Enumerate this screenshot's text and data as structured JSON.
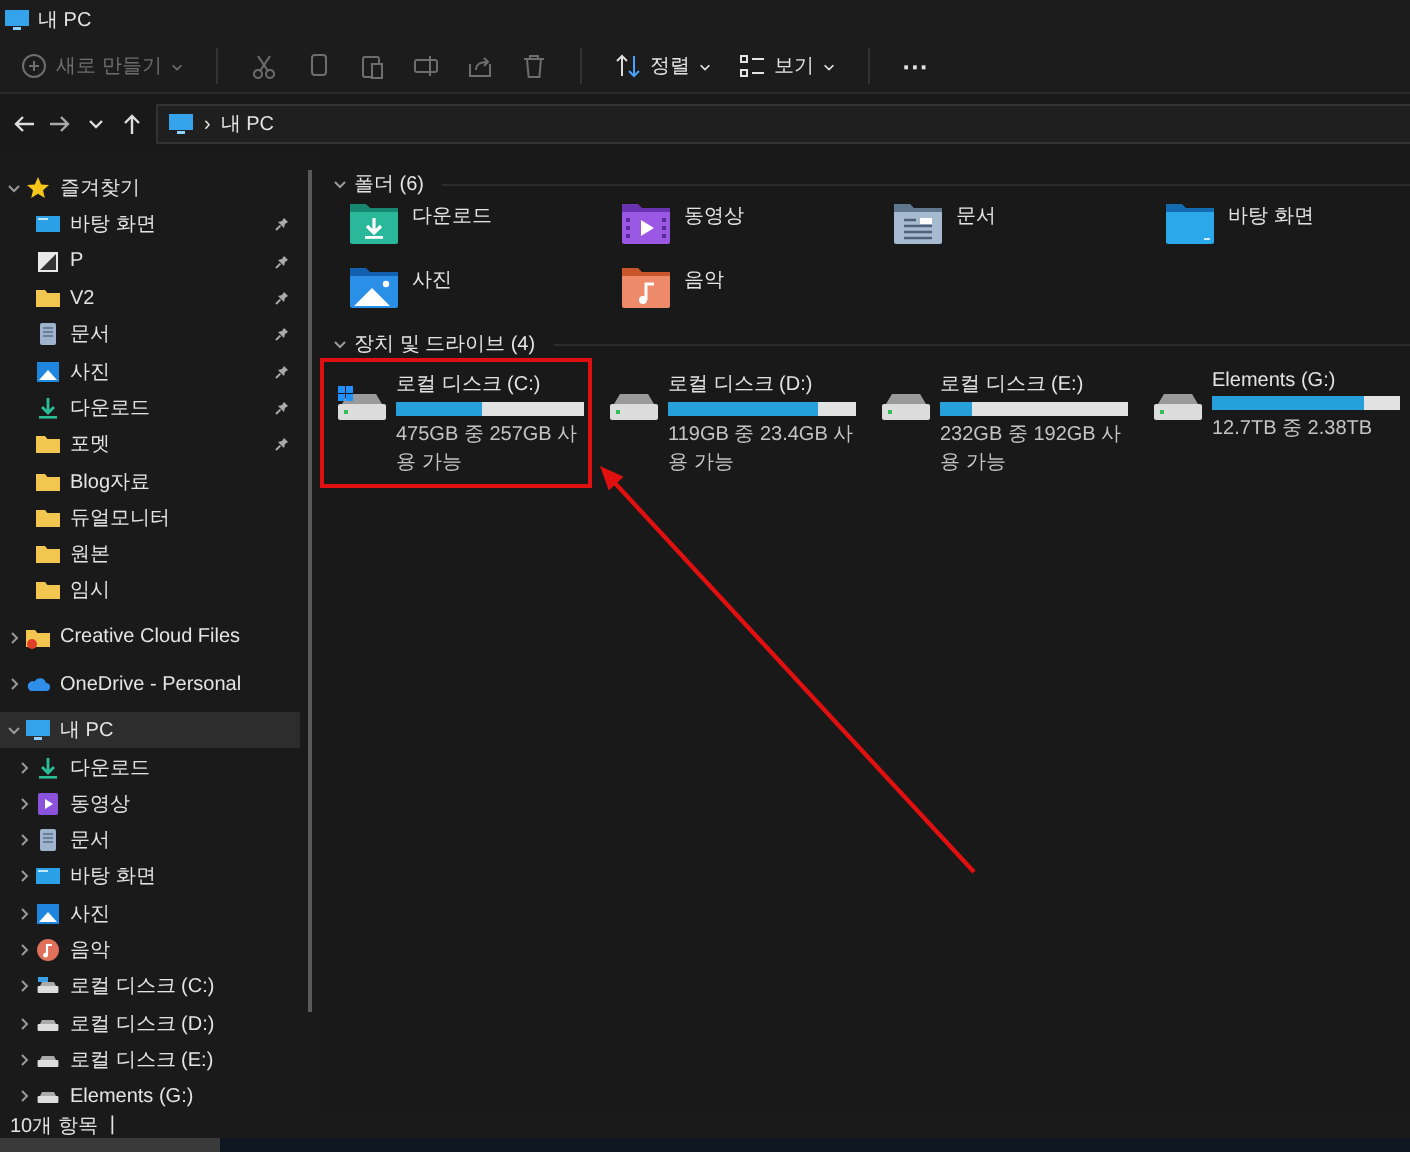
{
  "window": {
    "title": "내 PC"
  },
  "toolbar": {
    "items": [
      {
        "kind": "new",
        "label": "새로 만들기",
        "disabled": true
      },
      {
        "kind": "cut",
        "disabled": true
      },
      {
        "kind": "copy",
        "disabled": true
      },
      {
        "kind": "paste",
        "disabled": true
      },
      {
        "kind": "rename",
        "disabled": true
      },
      {
        "kind": "share",
        "disabled": true
      },
      {
        "kind": "delete",
        "disabled": true
      },
      {
        "kind": "sort",
        "label": "정렬",
        "disabled": false
      },
      {
        "kind": "view",
        "label": "보기",
        "disabled": false
      },
      {
        "kind": "more",
        "label": "···",
        "disabled": false
      }
    ]
  },
  "navigation": {
    "buttons": [
      {
        "kind": "back"
      },
      {
        "kind": "forward"
      },
      {
        "kind": "recent"
      },
      {
        "kind": "up"
      }
    ]
  },
  "address": {
    "separator": "›",
    "path": "내 PC"
  },
  "sidebar": {
    "items": [
      {
        "label": "즐겨찾기",
        "kind": "star",
        "expanded": true,
        "selected": false,
        "children": [
          {
            "label": "바탕 화면",
            "kind": "screen",
            "pinned": true,
            "selected": false
          },
          {
            "label": "P",
            "kind": "image",
            "pinned": true,
            "selected": false
          },
          {
            "label": "V2",
            "kind": "folder",
            "pinned": true,
            "selected": false
          },
          {
            "label": "문서",
            "kind": "document",
            "pinned": true,
            "selected": false
          },
          {
            "label": "사진",
            "kind": "picture",
            "pinned": true,
            "selected": false
          },
          {
            "label": "다운로드",
            "kind": "download",
            "pinned": true,
            "selected": false
          },
          {
            "label": "포멧",
            "kind": "folder",
            "pinned": true,
            "selected": false
          },
          {
            "label": "Blog자료",
            "kind": "folder",
            "pinned": false,
            "selected": false
          },
          {
            "label": "듀얼모니터",
            "kind": "folder",
            "pinned": false,
            "selected": false
          },
          {
            "label": "원본",
            "kind": "folder",
            "pinned": false,
            "selected": false
          },
          {
            "label": "임시",
            "kind": "folder",
            "pinned": false,
            "selected": false
          }
        ]
      },
      {
        "label": "Creative Cloud Files",
        "kind": "cc-folder",
        "expanded": false,
        "selected": false
      },
      {
        "label": "OneDrive - Personal",
        "kind": "cloud",
        "expanded": false,
        "selected": false
      },
      {
        "label": "내 PC",
        "kind": "monitor",
        "expanded": true,
        "selected": true,
        "children": [
          {
            "label": "다운로드",
            "kind": "download",
            "expanded": false,
            "selected": false
          },
          {
            "label": "동영상",
            "kind": "video",
            "expanded": false,
            "selected": false
          },
          {
            "label": "문서",
            "kind": "document",
            "expanded": false,
            "selected": false
          },
          {
            "label": "바탕 화면",
            "kind": "screen",
            "expanded": false,
            "selected": false
          },
          {
            "label": "사진",
            "kind": "picture",
            "expanded": false,
            "selected": false
          },
          {
            "label": "음악",
            "kind": "music",
            "expanded": false,
            "selected": false
          },
          {
            "label": "로컬 디스크 (C:)",
            "kind": "drive-windows",
            "expanded": false,
            "selected": false
          },
          {
            "label": "로컬 디스크 (D:)",
            "kind": "drive",
            "expanded": false,
            "selected": false
          },
          {
            "label": "로컬 디스크 (E:)",
            "kind": "drive",
            "expanded": false,
            "selected": false
          },
          {
            "label": "Elements (G:)",
            "kind": "drive",
            "expanded": false,
            "selected": false
          }
        ]
      }
    ]
  },
  "content": {
    "sections": [
      {
        "title": "폴더 (6)",
        "kind": "folders",
        "expanded": true,
        "items": [
          {
            "label": "다운로드",
            "kind": "download"
          },
          {
            "label": "동영상",
            "kind": "video"
          },
          {
            "label": "문서",
            "kind": "document"
          },
          {
            "label": "바탕 화면",
            "kind": "desktop"
          },
          {
            "label": "사진",
            "kind": "picture"
          },
          {
            "label": "음악",
            "kind": "music"
          }
        ]
      },
      {
        "title": "장치 및 드라이브 (4)",
        "kind": "drives",
        "expanded": true,
        "items": [
          {
            "label": "로컬 디스크 (C:)",
            "kind": "drive-windows",
            "level": 0.46,
            "space": "475GB 중 257GB 사용 가능",
            "highlighted": true
          },
          {
            "label": "로컬 디스크 (D:)",
            "kind": "drive",
            "level": 0.8,
            "space": "119GB 중 23.4GB 사용 가능",
            "highlighted": false
          },
          {
            "label": "로컬 디스크 (E:)",
            "kind": "drive",
            "level": 0.17,
            "space": "232GB 중 192GB 사용 가능",
            "highlighted": false
          },
          {
            "label": "Elements (G:)",
            "kind": "drive",
            "level": 0.81,
            "space": "12.7TB 중 2.38TB",
            "highlighted": false
          }
        ]
      }
    ]
  },
  "status_bar": {
    "count": "10개 항목",
    "separator": "|"
  }
}
